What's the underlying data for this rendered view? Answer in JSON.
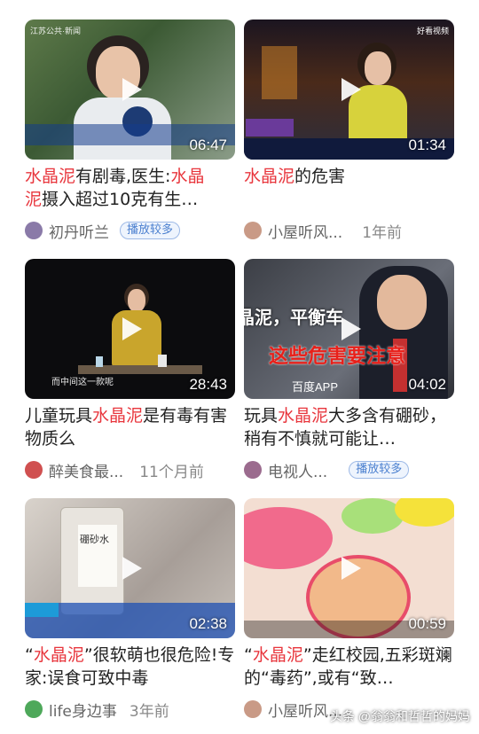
{
  "videos": [
    {
      "title_parts": [
        "水晶泥",
        "有剧毒,医生:",
        "水晶",
        "泥",
        "摄入超过10克有生…"
      ],
      "duration": "06:47",
      "author": "初丹听兰",
      "age": "",
      "tag": "播放较多",
      "thumb_badge": "江苏公共·新闻",
      "avatar_color": "#8a7aa8"
    },
    {
      "title_parts": [
        "水晶泥",
        "的危害"
      ],
      "duration": "01:34",
      "author": "小屋听风...",
      "age": "1年前",
      "tag": "",
      "thumb_badge": "好看视频",
      "avatar_color": "#c99a86"
    },
    {
      "title_parts": [
        "儿童玩具",
        "水晶泥",
        "是有毒有害物质么"
      ],
      "duration": "28:43",
      "author": "醉美食最...",
      "age": "11个月前",
      "tag": "",
      "thumb_badge": "",
      "thumb_caption": "而中间这一款呢",
      "avatar_color": "#d05050"
    },
    {
      "title_parts": [
        "玩具",
        "水晶泥",
        "大多含有硼砂，稍有不慎就可能让…"
      ],
      "duration": "04:02",
      "author": "电视人...",
      "age": "",
      "tag": "播放较多",
      "thumb_badge": "",
      "thumb_caption": "晶泥，平衡车",
      "thumb_caption2": "这些危害要注意",
      "thumb_caption3": "百度APP",
      "avatar_color": "#9b6b8e"
    },
    {
      "title_parts": [
        "“",
        "水晶泥",
        "”很软萌也很危险!专家:误食可致中毒"
      ],
      "duration": "02:38",
      "author": "life身边事",
      "age": "3年前",
      "tag": "",
      "thumb_badge": "",
      "thumb_caption": "硼砂水",
      "avatar_color": "#4ea85a"
    },
    {
      "title_parts": [
        "“",
        "水晶泥",
        "”走红校园,五彩斑斓的“毒药”,或有“致…"
      ],
      "duration": "00:59",
      "author": "小屋听风...",
      "age": "",
      "tag": "",
      "thumb_badge": "",
      "avatar_color": "#c99a86"
    }
  ],
  "watermark": "头条 @翁翁和哲哲的妈妈"
}
